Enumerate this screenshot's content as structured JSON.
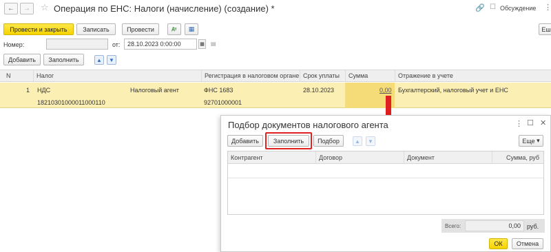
{
  "window": {
    "title": "Операция по ЕНС: Налоги (начисление) (создание) *",
    "discussion_label": "Обсуждение"
  },
  "toolbar": {
    "post_close_label": "Провести и закрыть",
    "save_label": "Записать",
    "post_label": "Провести",
    "more_label": "Еш"
  },
  "form": {
    "number_label": "Номер:",
    "number_value": "",
    "date_label": "от:",
    "date_value": "28.10.2023  0:00:00"
  },
  "table_toolbar": {
    "add_label": "Добавить",
    "fill_label": "Заполнить"
  },
  "table": {
    "columns": [
      "N",
      "Налог",
      "Регистрация в налоговом органе",
      "Срок уплаты",
      "Сумма",
      "Отражение в учете"
    ],
    "rows": [
      {
        "n": "1",
        "tax": "НДС",
        "tax_type": "Налоговый агент",
        "kbk": "18210301000011000110",
        "registration": "ФНС 1683",
        "oktmo": "92701000001",
        "due_date": "28.10.2023",
        "amount": "0,00",
        "accounting": "Бухгалтерский, налоговый учет и ЕНС"
      }
    ]
  },
  "dialog": {
    "title": "Подбор документов налогового агента",
    "add_label": "Добавить",
    "fill_label": "Заполнить",
    "select_label": "Подбор",
    "more_label": "Еще",
    "columns": [
      "Контрагент",
      "Договор",
      "Документ",
      "Сумма, руб"
    ],
    "total_label": "Всего:",
    "total_value": "0,00",
    "currency": "руб.",
    "ok_label": "ОК",
    "cancel_label": "Отмена"
  },
  "colors": {
    "accent_yellow": "#f5d300",
    "selected_row": "#fbefb4",
    "highlight_red": "#e02020"
  }
}
